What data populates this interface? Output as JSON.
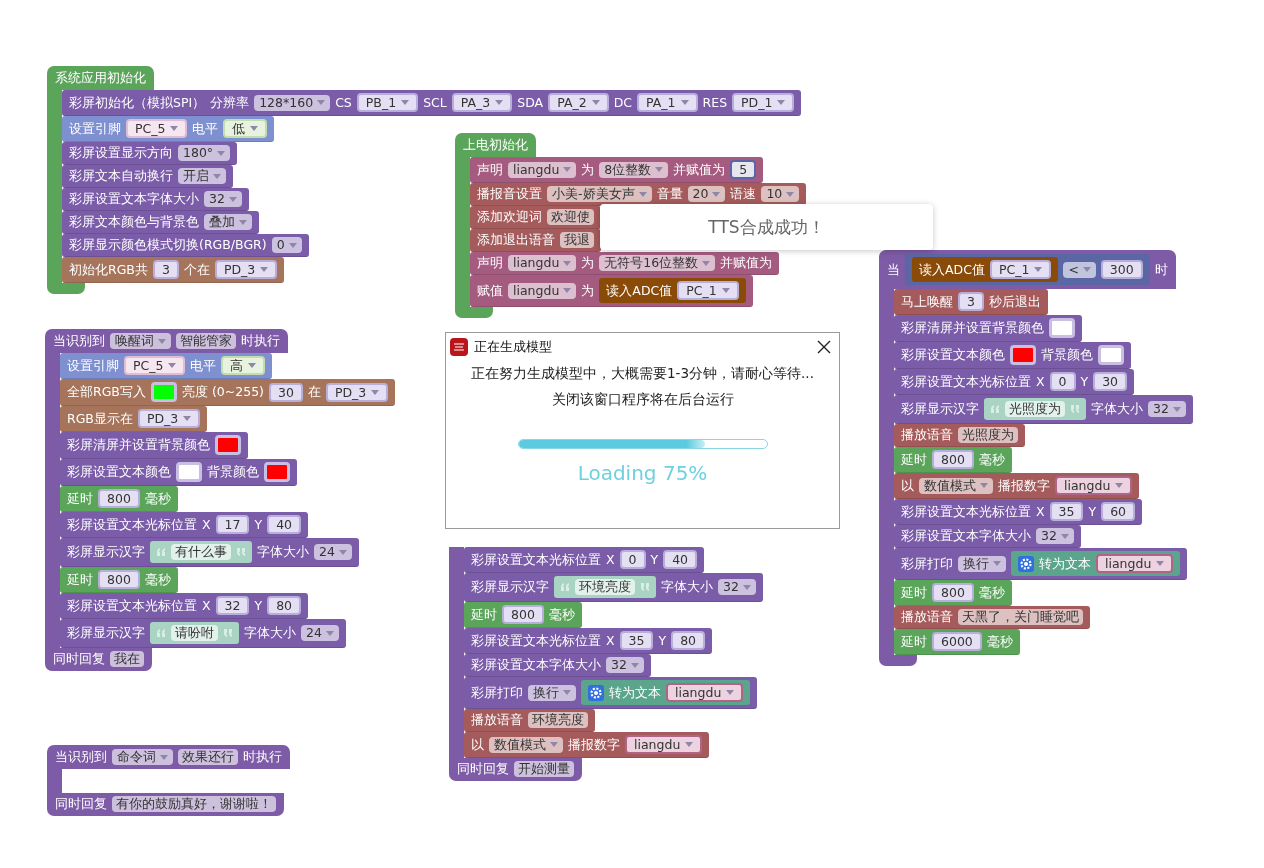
{
  "stacks": [
    {
      "hat": {
        "kind": "control",
        "parts": [
          {
            "kind": "label",
            "text": "系统应用初始化"
          }
        ]
      },
      "body": [
        {
          "kind": "display",
          "parts": [
            {
              "kind": "label",
              "text": "彩屏初始化（模拟SPI）"
            },
            {
              "kind": "label",
              "text": "分辨率"
            },
            {
              "kind": "dropdown",
              "text": "128*160"
            },
            {
              "kind": "label",
              "text": "CS"
            },
            {
              "kind": "pin_dropdown",
              "text": "PB_1"
            },
            {
              "kind": "label",
              "text": "SCL"
            },
            {
              "kind": "pin_dropdown",
              "text": "PA_3"
            },
            {
              "kind": "label",
              "text": "SDA"
            },
            {
              "kind": "pin_dropdown",
              "text": "PA_2"
            },
            {
              "kind": "label",
              "text": "DC"
            },
            {
              "kind": "pin_dropdown",
              "text": "PA_1"
            },
            {
              "kind": "label",
              "text": "RES"
            },
            {
              "kind": "pin_dropdown",
              "text": "PD_1"
            }
          ]
        },
        {
          "kind": "gpio",
          "parts": [
            {
              "kind": "label",
              "text": "设置引脚"
            },
            {
              "kind": "gpio_dropdown",
              "text": "PC_5"
            },
            {
              "kind": "label",
              "text": "电平"
            },
            {
              "kind": "level_dropdown",
              "text": "低"
            }
          ]
        },
        {
          "kind": "display",
          "parts": [
            {
              "kind": "label",
              "text": "彩屏设置显示方向"
            },
            {
              "kind": "dropdown",
              "text": "180°"
            }
          ]
        },
        {
          "kind": "display",
          "parts": [
            {
              "kind": "label",
              "text": "彩屏文本自动换行"
            },
            {
              "kind": "dropdown",
              "text": "开启"
            }
          ]
        },
        {
          "kind": "display",
          "parts": [
            {
              "kind": "label",
              "text": "彩屏设置文本字体大小"
            },
            {
              "kind": "dropdown",
              "text": "32"
            }
          ]
        },
        {
          "kind": "display",
          "parts": [
            {
              "kind": "label",
              "text": "彩屏文本颜色与背景色"
            },
            {
              "kind": "dropdown",
              "text": "叠加"
            }
          ]
        },
        {
          "kind": "display",
          "parts": [
            {
              "kind": "label",
              "text": "彩屏显示颜色模式切换(RGB/BGR)"
            },
            {
              "kind": "dropdown",
              "text": "0"
            }
          ]
        },
        {
          "kind": "rgb",
          "parts": [
            {
              "kind": "label",
              "text": "初始化RGB共"
            },
            {
              "kind": "number",
              "text": "3"
            },
            {
              "kind": "label",
              "text": "个在"
            },
            {
              "kind": "pin_dropdown",
              "text": "PD_3"
            }
          ]
        }
      ]
    },
    {
      "hat": {
        "kind": "control",
        "parts": [
          {
            "kind": "label",
            "text": "上电初始化"
          }
        ]
      },
      "body": [
        {
          "kind": "variable",
          "parts": [
            {
              "kind": "label",
              "text": "声明"
            },
            {
              "kind": "dropdown",
              "text": "liangdu"
            },
            {
              "kind": "label",
              "text": "为"
            },
            {
              "kind": "dropdown",
              "text": "8位整数"
            },
            {
              "kind": "label",
              "text": "并赋值为"
            },
            {
              "kind": "math_number",
              "text": "5"
            }
          ]
        },
        {
          "kind": "voice",
          "parts": [
            {
              "kind": "label",
              "text": "播报音设置"
            },
            {
              "kind": "dropdown",
              "text": "小美-娇美女声"
            },
            {
              "kind": "label",
              "text": "音量"
            },
            {
              "kind": "dropdown",
              "text": "20"
            },
            {
              "kind": "label",
              "text": "语速"
            },
            {
              "kind": "dropdown",
              "text": "10"
            }
          ]
        },
        {
          "kind": "voice",
          "parts": [
            {
              "kind": "label",
              "text": "添加欢迎词"
            },
            {
              "kind": "text",
              "text": "欢迎使"
            }
          ]
        },
        {
          "kind": "voice",
          "parts": [
            {
              "kind": "label",
              "text": "添加退出语音"
            },
            {
              "kind": "text",
              "text": "我退"
            }
          ]
        },
        {
          "kind": "variable",
          "parts": [
            {
              "kind": "label",
              "text": "声明"
            },
            {
              "kind": "dropdown",
              "text": "liangdu"
            },
            {
              "kind": "label",
              "text": "为"
            },
            {
              "kind": "dropdown",
              "text": "无符号16位整数"
            },
            {
              "kind": "label",
              "text": "并赋值为"
            }
          ]
        },
        {
          "kind": "variable",
          "parts": [
            {
              "kind": "label",
              "text": "赋值"
            },
            {
              "kind": "dropdown",
              "text": "liangdu"
            },
            {
              "kind": "label",
              "text": "为"
            },
            {
              "kind": "adc_block",
              "parts": [
                {
                  "kind": "label",
                  "text": "读入ADC值"
                },
                {
                  "kind": "pin_dropdown",
                  "text": "PC_1"
                }
              ]
            }
          ]
        }
      ]
    },
    {
      "hat": {
        "kind": "event",
        "parts": [
          {
            "kind": "label",
            "text": "当识别到"
          },
          {
            "kind": "dropdown",
            "text": "唤醒词"
          },
          {
            "kind": "text",
            "text": "智能管家"
          },
          {
            "kind": "label",
            "text": "时执行"
          }
        ]
      },
      "body": [
        {
          "kind": "gpio",
          "parts": [
            {
              "kind": "label",
              "text": "设置引脚"
            },
            {
              "kind": "gpio_dropdown",
              "text": "PC_5"
            },
            {
              "kind": "label",
              "text": "电平"
            },
            {
              "kind": "level_dropdown",
              "text": "高"
            }
          ]
        },
        {
          "kind": "rgb",
          "parts": [
            {
              "kind": "label",
              "text": "全部RGB写入"
            },
            {
              "kind": "color",
              "color": "#00ff00"
            },
            {
              "kind": "label",
              "text": "亮度 (0~255)"
            },
            {
              "kind": "number",
              "text": "30"
            },
            {
              "kind": "label",
              "text": "在"
            },
            {
              "kind": "pin_dropdown",
              "text": "PD_3"
            }
          ]
        },
        {
          "kind": "rgb",
          "parts": [
            {
              "kind": "label",
              "text": "RGB显示在"
            },
            {
              "kind": "pin_dropdown",
              "text": "PD_3"
            }
          ]
        },
        {
          "kind": "display",
          "parts": [
            {
              "kind": "label",
              "text": "彩屏清屏并设置背景颜色"
            },
            {
              "kind": "color",
              "color": "#ff0000"
            }
          ]
        },
        {
          "kind": "display",
          "parts": [
            {
              "kind": "label",
              "text": "彩屏设置文本颜色"
            },
            {
              "kind": "color",
              "color": "#ffffff"
            },
            {
              "kind": "label",
              "text": "背景颜色"
            },
            {
              "kind": "color",
              "color": "#ff0000"
            }
          ]
        },
        {
          "kind": "delay",
          "parts": [
            {
              "kind": "label",
              "text": "延时"
            },
            {
              "kind": "number",
              "text": "800"
            },
            {
              "kind": "label",
              "text": "毫秒"
            }
          ]
        },
        {
          "kind": "display",
          "parts": [
            {
              "kind": "label",
              "text": "彩屏设置文本光标位置"
            },
            {
              "kind": "label",
              "text": "X"
            },
            {
              "kind": "number",
              "text": "17"
            },
            {
              "kind": "label",
              "text": "Y"
            },
            {
              "kind": "number",
              "text": "40"
            }
          ]
        },
        {
          "kind": "display",
          "parts": [
            {
              "kind": "label",
              "text": "彩屏显示汉字"
            },
            {
              "kind": "string",
              "text": "有什么事"
            },
            {
              "kind": "label",
              "text": "字体大小"
            },
            {
              "kind": "dropdown",
              "text": "24"
            }
          ]
        },
        {
          "kind": "delay",
          "parts": [
            {
              "kind": "label",
              "text": "延时"
            },
            {
              "kind": "number",
              "text": "800"
            },
            {
              "kind": "label",
              "text": "毫秒"
            }
          ]
        },
        {
          "kind": "display",
          "parts": [
            {
              "kind": "label",
              "text": "彩屏设置文本光标位置"
            },
            {
              "kind": "label",
              "text": "X"
            },
            {
              "kind": "number",
              "text": "32"
            },
            {
              "kind": "label",
              "text": "Y"
            },
            {
              "kind": "number",
              "text": "80"
            }
          ]
        },
        {
          "kind": "display",
          "parts": [
            {
              "kind": "label",
              "text": "彩屏显示汉字"
            },
            {
              "kind": "string",
              "text": "请吩咐"
            },
            {
              "kind": "label",
              "text": "字体大小"
            },
            {
              "kind": "dropdown",
              "text": "24"
            }
          ]
        }
      ],
      "footer": {
        "kind": "event",
        "parts": [
          {
            "kind": "label",
            "text": "同时回复"
          },
          {
            "kind": "text",
            "text": "我在"
          }
        ]
      }
    },
    {
      "hat": {
        "kind": "event",
        "parts": [
          {
            "kind": "label",
            "text": "当"
          },
          {
            "kind": "logic_block",
            "parts": [
              {
                "kind": "adc_block",
                "parts": [
                  {
                    "kind": "label",
                    "text": "读入ADC值"
                  },
                  {
                    "kind": "pin_dropdown",
                    "text": "PC_1"
                  }
                ]
              },
              {
                "kind": "dropdown",
                "text": "<"
              },
              {
                "kind": "number",
                "text": "300"
              }
            ]
          },
          {
            "kind": "label",
            "text": "时"
          }
        ]
      },
      "body": [
        {
          "kind": "voice",
          "parts": [
            {
              "kind": "label",
              "text": "马上唤醒"
            },
            {
              "kind": "number",
              "text": "3"
            },
            {
              "kind": "label",
              "text": "秒后退出"
            }
          ]
        },
        {
          "kind": "display",
          "parts": [
            {
              "kind": "label",
              "text": "彩屏清屏并设置背景颜色"
            },
            {
              "kind": "color",
              "color": "#ffffff"
            }
          ]
        },
        {
          "kind": "display",
          "parts": [
            {
              "kind": "label",
              "text": "彩屏设置文本颜色"
            },
            {
              "kind": "color",
              "color": "#ff0000"
            },
            {
              "kind": "label",
              "text": "背景颜色"
            },
            {
              "kind": "color",
              "color": "#ffffff"
            }
          ]
        },
        {
          "kind": "display",
          "parts": [
            {
              "kind": "label",
              "text": "彩屏设置文本光标位置"
            },
            {
              "kind": "label",
              "text": "X"
            },
            {
              "kind": "number",
              "text": "0"
            },
            {
              "kind": "label",
              "text": "Y"
            },
            {
              "kind": "number",
              "text": "30"
            }
          ]
        },
        {
          "kind": "display",
          "parts": [
            {
              "kind": "label",
              "text": "彩屏显示汉字"
            },
            {
              "kind": "string",
              "text": "光照度为"
            },
            {
              "kind": "label",
              "text": "字体大小"
            },
            {
              "kind": "dropdown",
              "text": "32"
            }
          ]
        },
        {
          "kind": "voice",
          "parts": [
            {
              "kind": "label",
              "text": "播放语音"
            },
            {
              "kind": "text",
              "text": "光照度为"
            }
          ]
        },
        {
          "kind": "delay",
          "parts": [
            {
              "kind": "label",
              "text": "延时"
            },
            {
              "kind": "number",
              "text": "800"
            },
            {
              "kind": "label",
              "text": "毫秒"
            }
          ]
        },
        {
          "kind": "voice",
          "parts": [
            {
              "kind": "label",
              "text": "以"
            },
            {
              "kind": "dropdown",
              "text": "数值模式"
            },
            {
              "kind": "label",
              "text": "播报数字"
            },
            {
              "kind": "var_dropdown",
              "text": "liangdu"
            }
          ]
        },
        {
          "kind": "display",
          "parts": [
            {
              "kind": "label",
              "text": "彩屏设置文本光标位置"
            },
            {
              "kind": "label",
              "text": "X"
            },
            {
              "kind": "number",
              "text": "35"
            },
            {
              "kind": "label",
              "text": "Y"
            },
            {
              "kind": "number",
              "text": "60"
            }
          ]
        },
        {
          "kind": "display",
          "parts": [
            {
              "kind": "label",
              "text": "彩屏设置文本字体大小"
            },
            {
              "kind": "dropdown",
              "text": "32"
            }
          ]
        },
        {
          "kind": "display",
          "parts": [
            {
              "kind": "label",
              "text": "彩屏打印"
            },
            {
              "kind": "dropdown",
              "text": "换行"
            },
            {
              "kind": "text_block",
              "mutator": true,
              "parts": [
                {
                  "kind": "label",
                  "text": "转为文本"
                },
                {
                  "kind": "var_dropdown",
                  "text": "liangdu"
                }
              ]
            }
          ]
        },
        {
          "kind": "delay",
          "parts": [
            {
              "kind": "label",
              "text": "延时"
            },
            {
              "kind": "number",
              "text": "800"
            },
            {
              "kind": "label",
              "text": "毫秒"
            }
          ]
        },
        {
          "kind": "voice",
          "parts": [
            {
              "kind": "label",
              "text": "播放语音"
            },
            {
              "kind": "text",
              "text": "天黑了，关门睡觉吧"
            }
          ]
        },
        {
          "kind": "delay",
          "parts": [
            {
              "kind": "label",
              "text": "延时"
            },
            {
              "kind": "number",
              "text": "6000"
            },
            {
              "kind": "label",
              "text": "毫秒"
            }
          ]
        }
      ]
    },
    {
      "body": [
        {
          "kind": "display",
          "parts": [
            {
              "kind": "label",
              "text": "彩屏设置文本光标位置"
            },
            {
              "kind": "label",
              "text": "X"
            },
            {
              "kind": "number",
              "text": "0"
            },
            {
              "kind": "label",
              "text": "Y"
            },
            {
              "kind": "number",
              "text": "40"
            }
          ]
        },
        {
          "kind": "display",
          "parts": [
            {
              "kind": "label",
              "text": "彩屏显示汉字"
            },
            {
              "kind": "string",
              "text": "环境亮度"
            },
            {
              "kind": "label",
              "text": "字体大小"
            },
            {
              "kind": "dropdown",
              "text": "32"
            }
          ]
        },
        {
          "kind": "delay",
          "parts": [
            {
              "kind": "label",
              "text": "延时"
            },
            {
              "kind": "number",
              "text": "800"
            },
            {
              "kind": "label",
              "text": "毫秒"
            }
          ]
        },
        {
          "kind": "display",
          "parts": [
            {
              "kind": "label",
              "text": "彩屏设置文本光标位置"
            },
            {
              "kind": "label",
              "text": "X"
            },
            {
              "kind": "number",
              "text": "35"
            },
            {
              "kind": "label",
              "text": "Y"
            },
            {
              "kind": "number",
              "text": "80"
            }
          ]
        },
        {
          "kind": "display",
          "parts": [
            {
              "kind": "label",
              "text": "彩屏设置文本字体大小"
            },
            {
              "kind": "dropdown",
              "text": "32"
            }
          ]
        },
        {
          "kind": "display",
          "parts": [
            {
              "kind": "label",
              "text": "彩屏打印"
            },
            {
              "kind": "dropdown",
              "text": "换行"
            },
            {
              "kind": "text_block",
              "mutator": true,
              "parts": [
                {
                  "kind": "label",
                  "text": "转为文本"
                },
                {
                  "kind": "var_dropdown",
                  "text": "liangdu"
                }
              ]
            }
          ]
        },
        {
          "kind": "voice",
          "parts": [
            {
              "kind": "label",
              "text": "播放语音"
            },
            {
              "kind": "text",
              "text": "环境亮度"
            }
          ]
        },
        {
          "kind": "voice",
          "parts": [
            {
              "kind": "label",
              "text": "以"
            },
            {
              "kind": "dropdown",
              "text": "数值模式"
            },
            {
              "kind": "label",
              "text": "播报数字"
            },
            {
              "kind": "var_dropdown",
              "text": "liangdu"
            }
          ]
        }
      ],
      "footer": {
        "kind": "event",
        "parts": [
          {
            "kind": "label",
            "text": "同时回复"
          },
          {
            "kind": "text",
            "text": "开始测量"
          }
        ]
      }
    },
    {
      "hat": {
        "kind": "event",
        "parts": [
          {
            "kind": "label",
            "text": "当识别到"
          },
          {
            "kind": "dropdown",
            "text": "命令词"
          },
          {
            "kind": "text",
            "text": "效果还行"
          },
          {
            "kind": "label",
            "text": "时执行"
          }
        ]
      },
      "footer": {
        "kind": "event",
        "parts": [
          {
            "kind": "label",
            "text": "同时回复"
          },
          {
            "kind": "text",
            "text": "有你的鼓励真好，谢谢啦！"
          }
        ]
      }
    }
  ],
  "toast": {
    "text": "TTS合成成功！"
  },
  "dialog": {
    "title": "正在生成模型",
    "lines": [
      "正在努力生成模型中，大概需要1-3分钟，请耐心等待...",
      "关闭该窗口程序将在后台运行"
    ],
    "progress": {
      "level": 0.75
    },
    "progress_label": "Loading 75%"
  }
}
